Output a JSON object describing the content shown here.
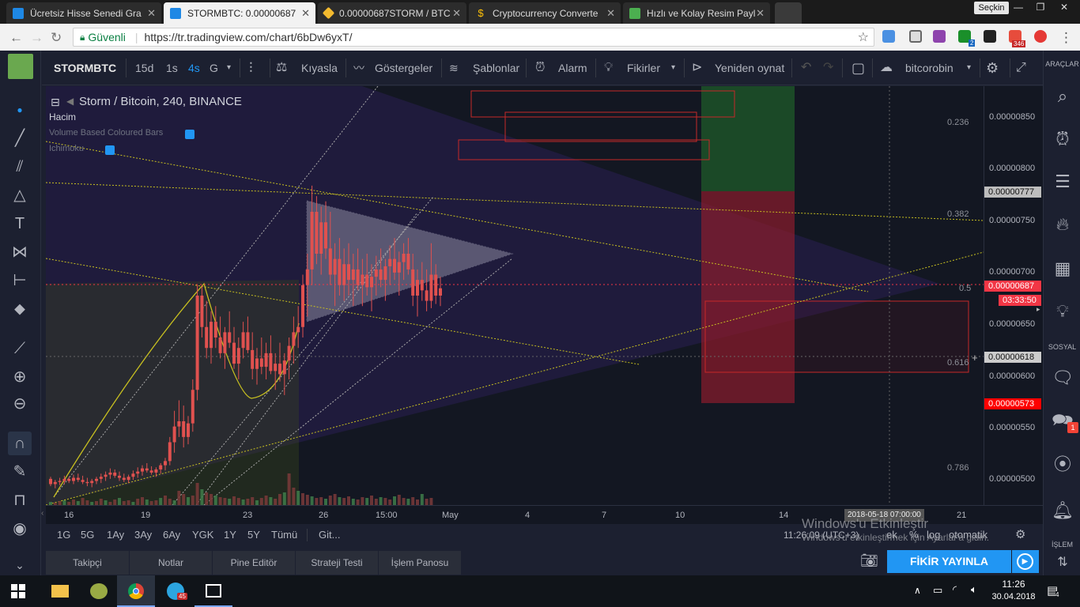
{
  "browser": {
    "tabs": [
      {
        "title": "Ücretsiz Hisse Senedi Gra",
        "color": "#1e88e5"
      },
      {
        "title": "STORMBTC: 0.00000687",
        "color": "#1e88e5"
      },
      {
        "title": "0.00000687STORM / BTC",
        "color": "#f3ba2f"
      },
      {
        "title": "Cryptocurrency Converte",
        "color": "#43a047"
      },
      {
        "title": "Hızlı ve Kolay Resim Payl",
        "color": "#4caf50"
      }
    ],
    "profile": "Seçkin",
    "secure_label": "Güvenli",
    "url": "https://tr.tradingview.com/chart/6bDw6yxT/",
    "ext_badges": {
      "count": "346",
      "small": "2"
    }
  },
  "toolbar": {
    "symbol": "STORMBTC",
    "intervals": [
      "15d",
      "1s",
      "4s",
      "G"
    ],
    "compare": "Kıyasla",
    "indicators": "Göstergeler",
    "templates": "Şablonlar",
    "alert": "Alarm",
    "ideas": "Fikirler",
    "replay": "Yeniden oynat",
    "user": "bitcorobin"
  },
  "right_toolbar": {
    "tools_label": "ARAÇLAR",
    "social_label": "SOSYAL",
    "trade_label": "İŞLEM",
    "chat_badge": "1"
  },
  "legend": {
    "title": "Storm / Bitcoin, 240, BINANCE",
    "volume": "Hacim",
    "vbcb": "Volume Based Coloured Bars",
    "ichimoku": "Ichimoku"
  },
  "price_axis": {
    "ticks": [
      "0.00000850",
      "0.00000800",
      "0.00000750",
      "0.00000700",
      "0.00000650",
      "0.00000600",
      "0.00000550",
      "0.00000500"
    ],
    "flags": [
      {
        "text": "0.00000777",
        "bg": "#bdbdbd",
        "fg": "#111111"
      },
      {
        "text": "0.00000687",
        "bg": "#f23645",
        "fg": "#ffffff"
      },
      {
        "text": "03:33:50",
        "bg": "#f23645",
        "fg": "#ffffff"
      },
      {
        "text": "0.00000618",
        "bg": "#cccccc",
        "fg": "#111111"
      },
      {
        "text": "0.00000573",
        "bg": "#ff0000",
        "fg": "#ffffff"
      }
    ]
  },
  "fib_levels": [
    "0.236",
    "0.382",
    "0.5",
    "0.616",
    "0.786"
  ],
  "time_axis": {
    "labels": [
      "16",
      "19",
      "23",
      "26",
      "15:00",
      "May",
      "4",
      "7",
      "10",
      "14",
      "21"
    ],
    "crosshair": "2018-05-18 07:00:00"
  },
  "range_bar": {
    "ranges": [
      "1G",
      "5G",
      "1Ay",
      "3Ay",
      "6Ay",
      "YGK",
      "1Y",
      "5Y",
      "Tümü"
    ],
    "goto": "Git...",
    "clock": "11:26:09 (UTC+3)",
    "options": [
      "ek",
      "%",
      "log",
      "otomatik"
    ]
  },
  "bottom_tabs": [
    "Takipçi",
    "Notlar",
    "Pine Editör",
    "Strateji Testi",
    "İşlem Panosu"
  ],
  "publish": "FİKİR YAYINLA",
  "watermark": {
    "line1": "Windows'u Etkinleştir",
    "line2": "Windows'u etkinleştirmek için Ayarlar'a gidin."
  },
  "taskbar": {
    "time": "11:26",
    "date": "30.04.2018",
    "telegram_badge": "45",
    "notif_count": "4"
  },
  "chart_data": {
    "type": "candlestick",
    "symbol": "Storm / Bitcoin, 240, BINANCE",
    "xlabel": "",
    "ylabel": "",
    "ylim": [
      4.8e-06,
      8.8e-06
    ],
    "last_price": 6.87e-06,
    "x_ticks": [
      "16",
      "19",
      "23",
      "26",
      "15:00",
      "May",
      "4",
      "7",
      "10",
      "14",
      "21"
    ],
    "y_ticks": [
      8.5e-06,
      8e-06,
      7.5e-06,
      7e-06,
      6.5e-06,
      6e-06,
      5.5e-06,
      5e-06
    ],
    "candles": [
      [
        5.05e-06,
        5.07e-06,
        4.98e-06,
        5e-06
      ],
      [
        5e-06,
        5.04e-06,
        4.96e-06,
        5.02e-06
      ],
      [
        5.02e-06,
        5.06e-06,
        4.99e-06,
        5.03e-06
      ],
      [
        5.03e-06,
        5.08e-06,
        5e-06,
        5.05e-06
      ],
      [
        5.05e-06,
        5.07e-06,
        5.01e-06,
        5.03e-06
      ],
      [
        5.03e-06,
        5.09e-06,
        5e-06,
        5.06e-06
      ],
      [
        5.06e-06,
        5.1e-06,
        5.02e-06,
        5.04e-06
      ],
      [
        5.04e-06,
        5.08e-06,
        5e-06,
        5.02e-06
      ],
      [
        5.02e-06,
        5.06e-06,
        4.98e-06,
        5.01e-06
      ],
      [
        5.01e-06,
        5.05e-06,
        4.97e-06,
        5.03e-06
      ],
      [
        5.03e-06,
        5.07e-06,
        5e-06,
        5.05e-06
      ],
      [
        5.05e-06,
        5.1e-06,
        5.01e-06,
        5.07e-06
      ],
      [
        5.07e-06,
        5.12e-06,
        5.03e-06,
        5.09e-06
      ],
      [
        5.09e-06,
        5.15e-06,
        5.05e-06,
        5.11e-06
      ],
      [
        5.11e-06,
        5.14e-06,
        5.06e-06,
        5.08e-06
      ],
      [
        5.08e-06,
        5.12e-06,
        5.03e-06,
        5.06e-06
      ],
      [
        5.06e-06,
        5.1e-06,
        5.02e-06,
        5.04e-06
      ],
      [
        5.04e-06,
        5.09e-06,
        5.01e-06,
        5.07e-06
      ],
      [
        5.07e-06,
        5.13e-06,
        5.04e-06,
        5.1e-06
      ],
      [
        5.1e-06,
        5.16e-06,
        5.06e-06,
        5.12e-06
      ],
      [
        5.12e-06,
        5.18e-06,
        5.08e-06,
        5.15e-06
      ],
      [
        5.15e-06,
        5.2e-06,
        5.11e-06,
        5.13e-06
      ],
      [
        5.13e-06,
        5.17e-06,
        5.09e-06,
        5.11e-06
      ],
      [
        5.11e-06,
        5.16e-06,
        5.07e-06,
        5.14e-06
      ],
      [
        5.14e-06,
        5.2e-06,
        5.1e-06,
        5.18e-06
      ],
      [
        5.18e-06,
        5.25e-06,
        5.13e-06,
        5.22e-06
      ],
      [
        5.22e-06,
        5.45e-06,
        5.18e-06,
        5.4e-06
      ],
      [
        5.4e-06,
        5.7e-06,
        5.3e-06,
        5.55e-06
      ],
      [
        5.55e-06,
        5.8e-06,
        5.45e-06,
        5.6e-06
      ],
      [
        5.6e-06,
        5.75e-06,
        5.35e-06,
        5.45e-06
      ],
      [
        5.45e-06,
        5.65e-06,
        5.38e-06,
        5.58e-06
      ],
      [
        5.58e-06,
        6e-06,
        5.5e-06,
        5.9e-06
      ],
      [
        5.9e-06,
        6.9e-06,
        5.8e-06,
        6.8e-06
      ],
      [
        6.8e-06,
        6.9e-06,
        6.4e-06,
        6.5e-06
      ],
      [
        6.5e-06,
        6.75e-06,
        6.2e-06,
        6.3e-06
      ],
      [
        6.3e-06,
        6.65e-06,
        6.15e-06,
        6.55e-06
      ],
      [
        6.55e-06,
        6.7e-06,
        6.3e-06,
        6.4e-06
      ],
      [
        6.4e-06,
        6.6e-06,
        6.2e-06,
        6.25e-06
      ],
      [
        6.25e-06,
        6.5e-06,
        6.1e-06,
        6.45e-06
      ],
      [
        6.45e-06,
        6.65e-06,
        6.3e-06,
        6.35e-06
      ],
      [
        6.35e-06,
        6.5e-06,
        6.1e-06,
        6.15e-06
      ],
      [
        6.15e-06,
        6.4e-06,
        6e-06,
        6.3e-06
      ],
      [
        6.3e-06,
        6.55e-06,
        6.2e-06,
        6.45e-06
      ],
      [
        6.45e-06,
        6.6e-06,
        6.25e-06,
        6.28e-06
      ],
      [
        6.28e-06,
        6.45e-06,
        6e-06,
        6.1e-06
      ],
      [
        6.1e-06,
        6.3e-06,
        5.95e-06,
        6.2e-06
      ],
      [
        6.2e-06,
        6.4e-06,
        6.05e-06,
        6.12e-06
      ],
      [
        6.12e-06,
        6.35e-06,
        6e-06,
        6.25e-06
      ],
      [
        6.25e-06,
        6.42e-06,
        6.05e-06,
        6.08e-06
      ],
      [
        6.08e-06,
        6.25e-06,
        5.9e-06,
        6.15e-06
      ],
      [
        6.15e-06,
        6.35e-06,
        5.98e-06,
        6.05e-06
      ],
      [
        6.05e-06,
        6.25e-06,
        5.85e-06,
        6.18e-06
      ],
      [
        6.18e-06,
        6.4e-06,
        6e-06,
        6.32e-06
      ],
      [
        6.32e-06,
        6.6e-06,
        6.15e-06,
        6.45e-06
      ],
      [
        6.45e-06,
        6.7e-06,
        6.3e-06,
        6.5e-06
      ],
      [
        6.5e-06,
        7e-06,
        6.4e-06,
        6.9e-06
      ],
      [
        6.9e-06,
        7.2e-06,
        6.6e-06,
        7.05e-06
      ],
      [
        7.05e-06,
        7.85e-06,
        6.9e-06,
        7.6e-06
      ],
      [
        7.6e-06,
        7.75e-06,
        7.1e-06,
        7.2e-06
      ],
      [
        7.2e-06,
        7.65e-06,
        7e-06,
        7.5e-06
      ],
      [
        7.5e-06,
        7.7e-06,
        7.15e-06,
        7.25e-06
      ],
      [
        7.25e-06,
        7.6e-06,
        6.9e-06,
        7e-06
      ],
      [
        7e-06,
        7.3e-06,
        6.7e-06,
        7.15e-06
      ],
      [
        7.15e-06,
        7.35e-06,
        6.8e-06,
        6.9e-06
      ],
      [
        6.9e-06,
        7.25e-06,
        6.75e-06,
        7.1e-06
      ],
      [
        7.1e-06,
        7.3e-06,
        6.8e-06,
        6.95e-06
      ],
      [
        6.95e-06,
        7.2e-06,
        6.7e-06,
        7.05e-06
      ],
      [
        7.05e-06,
        7.25e-06,
        6.85e-06,
        6.9e-06
      ],
      [
        6.9e-06,
        7.15e-06,
        6.7e-06,
        7e-06
      ],
      [
        7e-06,
        7.2e-06,
        6.8e-06,
        6.88e-06
      ],
      [
        6.88e-06,
        7.1e-06,
        6.65e-06,
        6.98e-06
      ],
      [
        6.98e-06,
        7.18e-06,
        6.8e-06,
        7.05e-06
      ],
      [
        7.05e-06,
        7.25e-06,
        6.88e-06,
        6.95e-06
      ],
      [
        6.95e-06,
        7.15e-06,
        6.75e-06,
        7.08e-06
      ],
      [
        7.08e-06,
        7.28e-06,
        6.9e-06,
        7.15e-06
      ],
      [
        7.15e-06,
        7.35e-06,
        6.95e-06,
        7.02e-06
      ],
      [
        7.02e-06,
        7.22e-06,
        6.8e-06,
        7.12e-06
      ],
      [
        7.12e-06,
        7.3e-06,
        6.95e-06,
        7.2e-06
      ],
      [
        7.2e-06,
        7.35e-06,
        7e-06,
        7.05e-06
      ],
      [
        7.05e-06,
        7.2e-06,
        6.7e-06,
        6.8e-06
      ],
      [
        6.8e-06,
        7.05e-06,
        6.6e-06,
        6.95e-06
      ],
      [
        6.95e-06,
        7.12e-06,
        6.75e-06,
        6.85e-06
      ],
      [
        6.85e-06,
        7.05e-06,
        6.65e-06,
        6.75e-06
      ],
      [
        6.75e-06,
        7.3e-06,
        6.68e-06,
        7e-06
      ],
      [
        7e-06,
        7.1e-06,
        6.72e-06,
        6.8e-06
      ],
      [
        6.8e-06,
        6.98e-06,
        6.7e-06,
        6.87e-06
      ]
    ],
    "volume_heights": [
      4,
      3,
      5,
      6,
      4,
      7,
      5,
      9,
      6,
      4,
      5,
      8,
      6,
      4,
      7,
      9,
      5,
      6,
      4,
      8,
      10,
      7,
      5,
      6,
      9,
      12,
      8,
      6,
      18,
      14,
      10,
      12,
      28,
      20,
      16,
      14,
      12,
      10,
      9,
      8,
      11,
      9,
      7,
      8,
      10,
      6,
      9,
      12,
      10,
      8,
      14,
      16,
      40,
      22,
      18,
      15,
      13,
      11,
      9,
      10,
      8,
      12,
      14,
      10,
      9,
      11,
      8,
      7,
      10,
      9,
      12,
      8,
      10,
      9,
      7,
      11,
      13,
      9,
      8,
      10,
      7,
      14,
      8,
      9
    ]
  }
}
